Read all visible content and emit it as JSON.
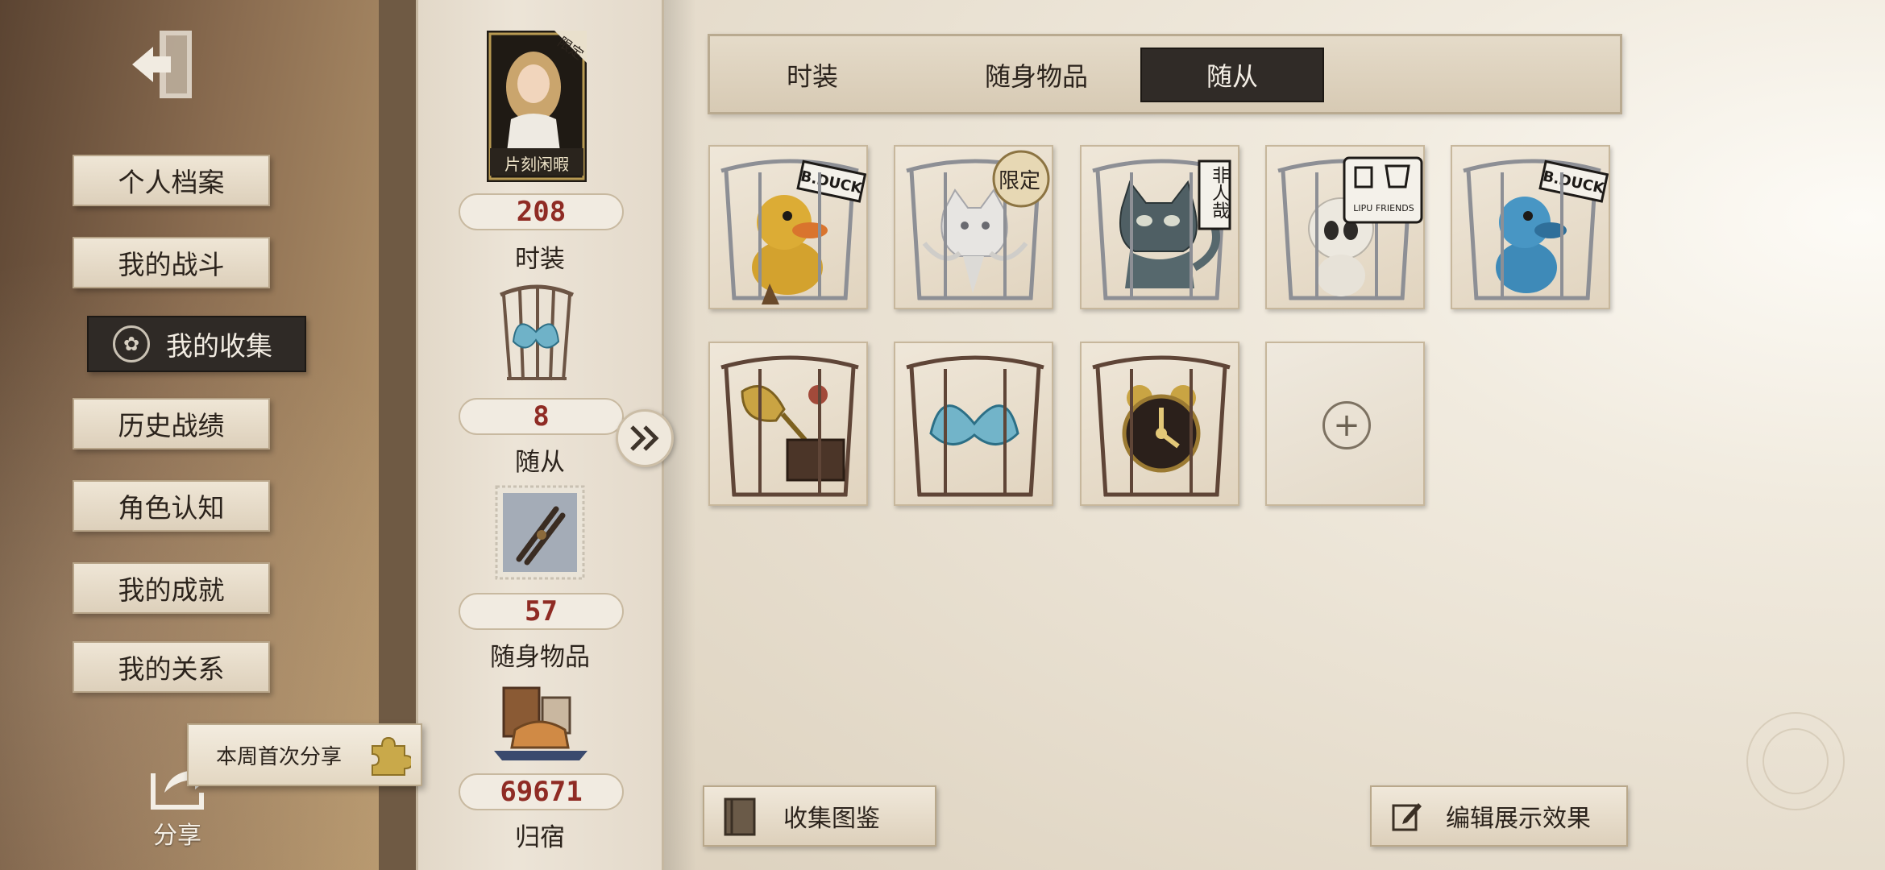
{
  "sidebar": {
    "items": [
      {
        "label": "个人档案"
      },
      {
        "label": "我的战斗"
      },
      {
        "label": "我的收集",
        "active": true
      },
      {
        "label": "历史战绩"
      },
      {
        "label": "角色认知"
      },
      {
        "label": "我的成就"
      },
      {
        "label": "我的关系"
      }
    ],
    "share_tip": "本周首次分享",
    "share_label": "分享"
  },
  "stats": [
    {
      "count": "208",
      "label": "时装",
      "card_label": "片刻闲暇",
      "card_badge": "限定"
    },
    {
      "count": "8",
      "label": "随从"
    },
    {
      "count": "57",
      "label": "随身物品"
    },
    {
      "count": "69671",
      "label": "归宿"
    }
  ],
  "tabs": [
    {
      "label": "时装",
      "active": false
    },
    {
      "label": "随身物品",
      "active": false
    },
    {
      "label": "随从",
      "active": true
    }
  ],
  "collection": {
    "items": [
      {
        "name": "yellow-duck-pet",
        "tag": "B.DUCK"
      },
      {
        "name": "white-ghost-cat-pet",
        "tag": "限定"
      },
      {
        "name": "dark-cat-pet",
        "tag": "非人哉"
      },
      {
        "name": "white-bunny-pet",
        "tag": "LIPU FRIENDS"
      },
      {
        "name": "blue-duck-pet",
        "tag": "B.DUCK"
      },
      {
        "name": "gramophone-pet",
        "tag": ""
      },
      {
        "name": "blue-butterfly-pet",
        "tag": ""
      },
      {
        "name": "alarm-clock-pet",
        "tag": ""
      },
      {
        "name": "empty-slot",
        "tag": ""
      }
    ],
    "add_symbol": "+"
  },
  "buttons": {
    "catalog": "收集图鉴",
    "edit_display": "编辑展示效果"
  },
  "colors": {
    "count_red": "#8f2b24",
    "active_dark": "#302b27",
    "paper": "#ece4d7"
  }
}
